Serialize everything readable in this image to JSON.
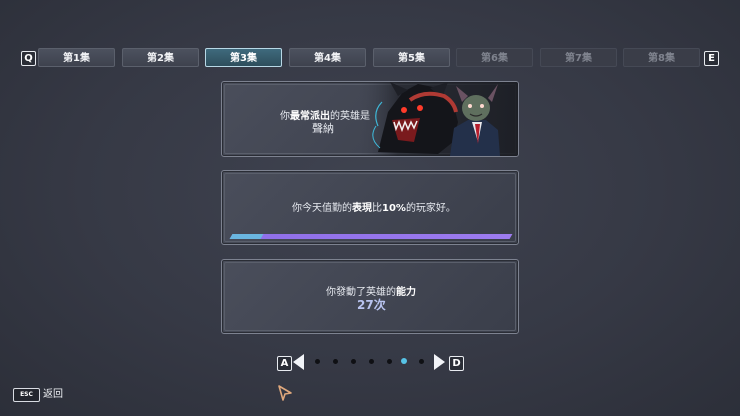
{
  "tabs": {
    "prev_key": "Q",
    "next_key": "E",
    "items": [
      {
        "label": "第1集",
        "state": "done"
      },
      {
        "label": "第2集",
        "state": "done"
      },
      {
        "label": "第3集",
        "state": "current"
      },
      {
        "label": "第4集",
        "state": "done"
      },
      {
        "label": "第5集",
        "state": "done"
      },
      {
        "label": "第6集",
        "state": "locked"
      },
      {
        "label": "第7集",
        "state": "locked"
      },
      {
        "label": "第8集",
        "state": "locked"
      }
    ]
  },
  "cards": {
    "hero": {
      "pre": "你",
      "bold": "最常派出",
      "post": "的英雄是",
      "name": "聲納"
    },
    "performance": {
      "pre": "你今天值勤的",
      "bold1": "表現",
      "mid": "比",
      "bold2": "10%",
      "post": "的玩家好。",
      "percent": 10
    },
    "ability": {
      "pre": "你發動了英雄的",
      "bold": "能力",
      "count": "27次"
    }
  },
  "pager": {
    "prev_key": "A",
    "next_key": "D",
    "total": 7,
    "current": 6
  },
  "footer": {
    "esc_key": "ESC",
    "back_label": "返回"
  },
  "colors": {
    "accent": "#57c3e6",
    "progress": "#9d7cf0",
    "highlight": "#b9c4f0"
  }
}
